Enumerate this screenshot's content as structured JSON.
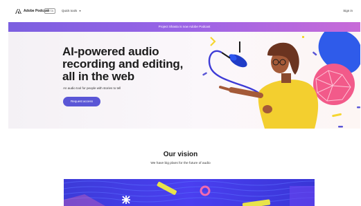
{
  "nav": {
    "logo_text": "Adobe Podcast",
    "beta": "BETA",
    "quick_tools": "Quick tools",
    "sign_in": "Sign in"
  },
  "banner": {
    "text": "Project Shasta is now Adobe Podcast"
  },
  "hero": {
    "title_line1": "AI-powered audio",
    "title_line2": "recording and editing,",
    "title_line3": "all in the web",
    "subtitle": "An audio tool for people with stories to tell",
    "cta": "Request access"
  },
  "vision": {
    "title": "Our vision",
    "subtitle": "We have big plans for the future of audio"
  },
  "colors": {
    "accent": "#5a56d6",
    "banner_start": "#7b5fe0",
    "banner_end": "#c86bd8",
    "vision_bg": "#3c3bd8"
  }
}
